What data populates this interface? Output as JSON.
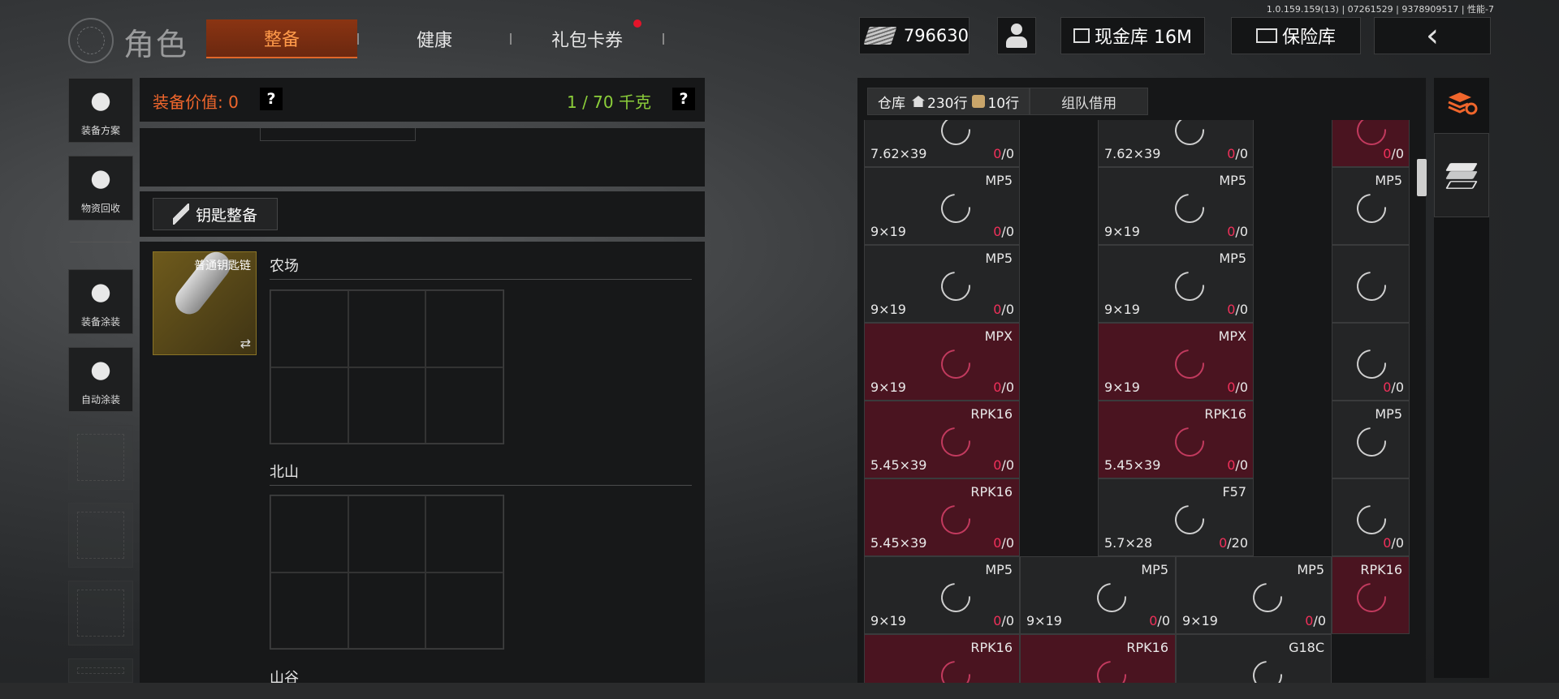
{
  "version": "1.0.159.159(13) | 07261529 | 9378909517 | 性能-7",
  "header": {
    "title": "角色",
    "tabs": [
      {
        "label": "整备",
        "active": true
      },
      {
        "label": "健康",
        "active": false
      },
      {
        "label": "礼包卡券",
        "active": false,
        "dot": true
      }
    ],
    "money": "796630",
    "cash_vault": "现金库 16M",
    "safe_vault": "保险库",
    "back_icon": "‹"
  },
  "sidebar": [
    {
      "label": "装备方案",
      "icon": "helmet-icon"
    },
    {
      "label": "物资回收",
      "icon": "recycle-icon"
    },
    {
      "label": "装备涂装",
      "icon": "paint-helmet-icon"
    },
    {
      "label": "自动涂装",
      "icon": "brush-gear-icon"
    }
  ],
  "gear": {
    "value_label": "装备价值: 0",
    "help": "?",
    "weight": "1 / 70 千克",
    "key_button": "钥匙整备",
    "keychain_label": "普通钥匙链",
    "maps": [
      "农场",
      "北山",
      "山谷"
    ]
  },
  "warehouse": {
    "tab_label": "仓库",
    "rows_home": "230行",
    "rows_bag": "10行",
    "team_tab": "组队借用",
    "cells": [
      {
        "name": "",
        "cal": "7.62×39",
        "cur": "0",
        "max": "/0",
        "red": false
      },
      {
        "name": "",
        "cal": "7.62×39",
        "cur": "0",
        "max": "/0",
        "red": false
      },
      {
        "name": "",
        "cal": "",
        "cur": "0",
        "max": "/0",
        "red": true
      },
      {
        "name": "MP5",
        "cal": "9×19",
        "cur": "0",
        "max": "/0",
        "red": false
      },
      {
        "name": "MP5",
        "cal": "9×19",
        "cur": "0",
        "max": "/0",
        "red": false
      },
      {
        "name": "MP5",
        "cal": "",
        "cur": "",
        "max": "",
        "red": false
      },
      {
        "name": "MP5",
        "cal": "9×19",
        "cur": "0",
        "max": "/0",
        "red": false
      },
      {
        "name": "MP5",
        "cal": "9×19",
        "cur": "0",
        "max": "/0",
        "red": false
      },
      {
        "name": "",
        "cal": "",
        "cur": "",
        "max": "",
        "red": false
      },
      {
        "name": "MPX",
        "cal": "9×19",
        "cur": "0",
        "max": "/0",
        "red": true
      },
      {
        "name": "MPX",
        "cal": "9×19",
        "cur": "0",
        "max": "/0",
        "red": true
      },
      {
        "name": "",
        "cal": "",
        "cur": "0",
        "max": "/0",
        "red": false
      },
      {
        "name": "RPK16",
        "cal": "5.45×39",
        "cur": "0",
        "max": "/0",
        "red": true
      },
      {
        "name": "RPK16",
        "cal": "5.45×39",
        "cur": "0",
        "max": "/0",
        "red": true
      },
      {
        "name": "MP5",
        "cal": "",
        "cur": "",
        "max": "",
        "red": false
      },
      {
        "name": "RPK16",
        "cal": "5.45×39",
        "cur": "0",
        "max": "/0",
        "red": true
      },
      {
        "name": "F57",
        "cal": "5.7×28",
        "cur": "0",
        "max": "/20",
        "red": false
      },
      {
        "name": "",
        "cal": "",
        "cur": "0",
        "max": "/0",
        "red": false
      },
      {
        "name": "MP5",
        "cal": "9×19",
        "cur": "0",
        "max": "/0",
        "red": false
      },
      {
        "name": "MP5",
        "cal": "9×19",
        "cur": "0",
        "max": "/0",
        "red": false
      },
      {
        "name": "MP5",
        "cal": "9×19",
        "cur": "0",
        "max": "/0",
        "red": false
      },
      {
        "name": "RPK16",
        "cal": "",
        "cur": "",
        "max": "",
        "red": true
      },
      {
        "name": "RPK16",
        "cal": "",
        "cur": "",
        "max": "",
        "red": true
      },
      {
        "name": "RPK16",
        "cal": "",
        "cur": "",
        "max": "",
        "red": true
      },
      {
        "name": "G18C",
        "cal": "",
        "cur": "",
        "max": "",
        "red": false
      }
    ]
  }
}
